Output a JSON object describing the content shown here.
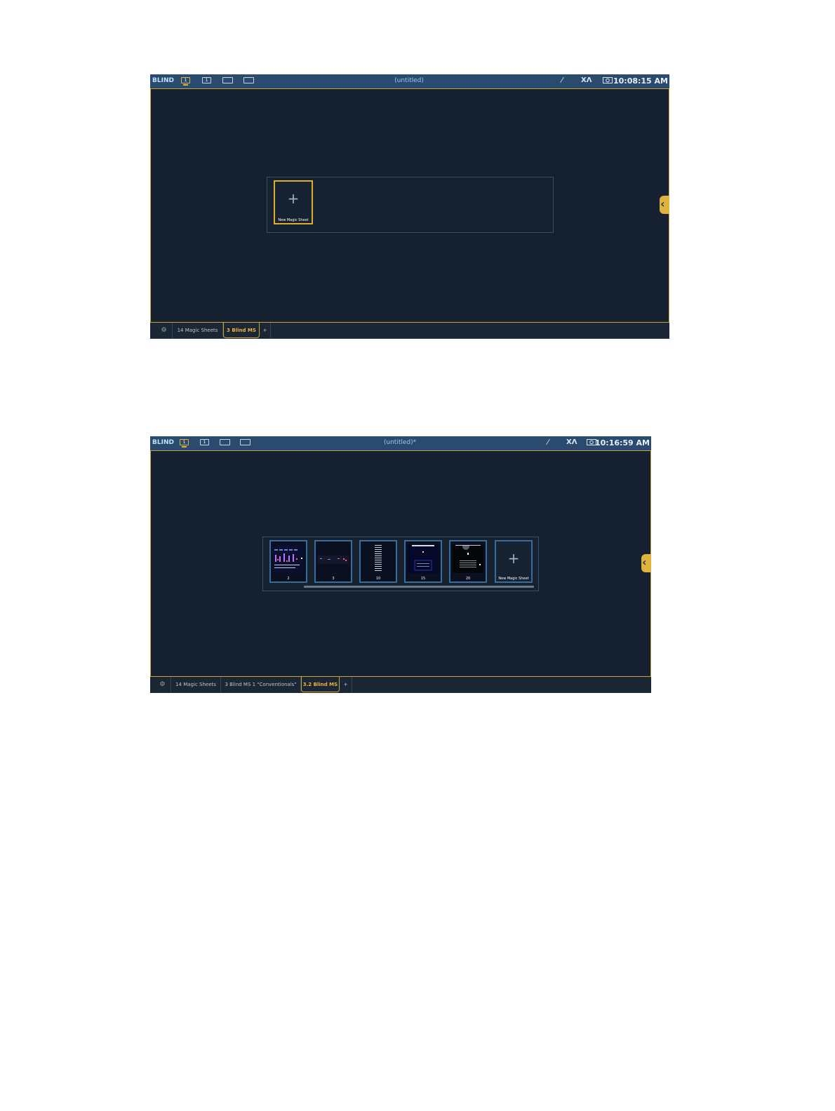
{
  "screens": [
    {
      "mode": "BLIND",
      "monitors": [
        "1",
        "1",
        "",
        ""
      ],
      "title": "(untitled)",
      "clock": "10:08:15 AM",
      "icons": [
        "magic-wand-icon",
        "network-icon",
        "camera-icon"
      ],
      "thumbnails": [
        {
          "label": "New Magic Sheet",
          "type": "new",
          "active": true
        }
      ],
      "tabs": [
        {
          "label": "14 Magic Sheets",
          "active": false
        },
        {
          "label": "3 Blind MS",
          "active": true
        },
        {
          "label": "+",
          "active": false
        }
      ]
    },
    {
      "mode": "BLIND",
      "monitors": [
        "1",
        "1",
        "",
        ""
      ],
      "title": "(untitled)*",
      "clock": "10:16:59 AM",
      "icons": [
        "magic-wand-icon",
        "network-icon",
        "camera-icon"
      ],
      "thumbnails": [
        {
          "label": "2",
          "type": "sheet"
        },
        {
          "label": "3",
          "type": "sheet"
        },
        {
          "label": "10",
          "type": "sheet"
        },
        {
          "label": "15",
          "type": "sheet"
        },
        {
          "label": "20",
          "type": "sheet"
        },
        {
          "label": "New Magic Sheet",
          "type": "new",
          "active": false
        }
      ],
      "tabs": [
        {
          "label": "14 Magic Sheets",
          "active": false
        },
        {
          "label": "3 Blind MS 1 \"Conventionals\"",
          "active": false
        },
        {
          "label": "3.2 Blind MS",
          "active": true
        },
        {
          "label": "+",
          "active": false
        }
      ]
    }
  ],
  "colors": {
    "accent": "#e0b43c",
    "background": "#152030",
    "titlebar": "#2a4a6e"
  }
}
